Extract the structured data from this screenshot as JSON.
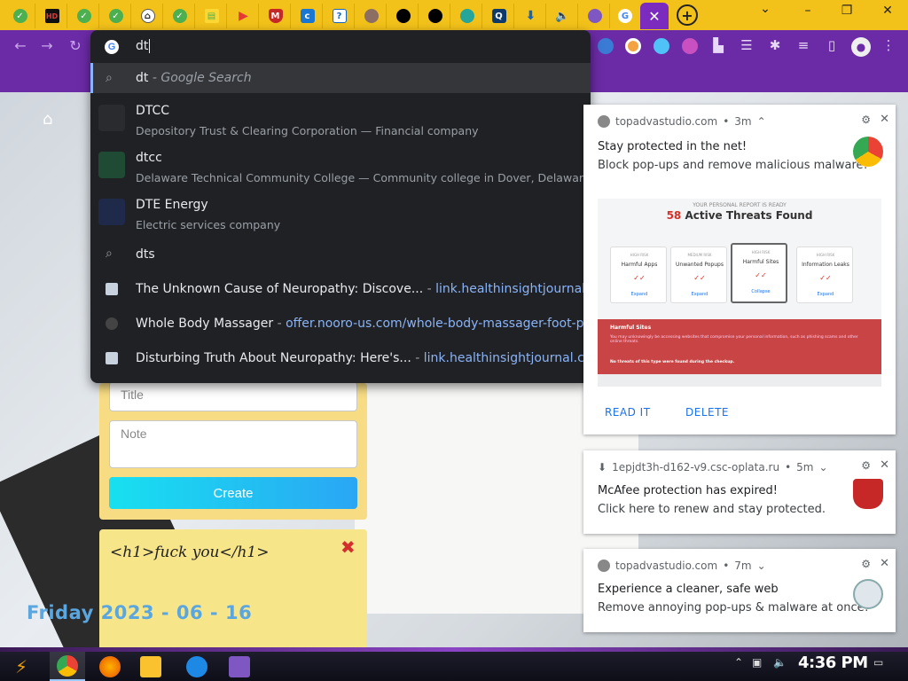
{
  "tabs": [
    {
      "icon": "check-icon"
    },
    {
      "icon": "hd-icon",
      "glyph": "HD"
    },
    {
      "icon": "check-icon"
    },
    {
      "icon": "check-icon"
    },
    {
      "icon": "home-icon"
    },
    {
      "icon": "check-icon"
    },
    {
      "icon": "doc-icon"
    },
    {
      "icon": "play-icon"
    },
    {
      "icon": "shield-icon"
    },
    {
      "icon": "c-icon",
      "glyph": "c"
    },
    {
      "icon": "question-icon",
      "glyph": "?"
    },
    {
      "icon": "circle-icon"
    },
    {
      "icon": "github-icon"
    },
    {
      "icon": "github-icon"
    },
    {
      "icon": "globe-icon"
    },
    {
      "icon": "qs-icon",
      "glyph": "Q"
    },
    {
      "icon": "download-icon",
      "glyph": "⬇"
    },
    {
      "icon": "sound-icon",
      "glyph": "🔈"
    },
    {
      "icon": "multi-icon"
    },
    {
      "icon": "google-icon",
      "glyph": "G"
    }
  ],
  "window_controls": {
    "minimize": "–",
    "restore": "❐",
    "close": "✕",
    "dropdown": "⌄"
  },
  "omnibox": {
    "query": "dt",
    "suggestions": [
      {
        "main": "dt",
        "hint": "- Google Search",
        "type": "search"
      },
      {
        "main": "DTCC",
        "sub": "Depository Trust & Clearing Corporation — Financial company",
        "type": "entity",
        "color": "#2a2b2e"
      },
      {
        "main": "dtcc",
        "sub": "Delaware Technical Community College — Community college in Dover, Delaware",
        "type": "entity",
        "color": "#1f4a33"
      },
      {
        "main": "DTE Energy",
        "sub": "Electric services company",
        "type": "entity",
        "color": "#1f2a4a"
      },
      {
        "main": "dts",
        "type": "search"
      },
      {
        "main": "The Unknown Cause of Neuropathy: Discove...",
        "sep": "-",
        "url": "link.healthinsightjournal.co...",
        "type": "history"
      },
      {
        "main": "Whole Body Massager",
        "sep": "-",
        "url": "offer.nooro-us.com/whole-body-massager-foot-pai...",
        "type": "history"
      },
      {
        "main": "Disturbing Truth About Neuropathy: Here's...",
        "sep": "-",
        "url": "link.healthinsightjournal.co...",
        "type": "history"
      }
    ]
  },
  "notes_app": {
    "title_placeholder": "Title",
    "note_placeholder": "Note",
    "create_label": "Create",
    "note_content": "<h1>fuck you</h1>",
    "delete_glyph": "✖",
    "date": "Friday 2023 - 06 - 16"
  },
  "notifications": [
    {
      "source": "topadvastudio.com",
      "time": "3m",
      "title": "Stay protected in the net!",
      "body": "Block pop-ups and remove malicious malware!",
      "image": {
        "small": "YOUR PERSONAL REPORT IS READY",
        "count": "58",
        "heading": "Active Threats Found",
        "cards": [
          {
            "risk": "HIGH RISK",
            "label": "Harmful Apps",
            "expand": "Expand"
          },
          {
            "risk": "MEDIUM RISK",
            "label": "Unwanted Popups",
            "expand": "Expand"
          },
          {
            "risk": "HIGH RISK",
            "label": "Harmful Sites",
            "expand": "Collapse"
          },
          {
            "risk": "HIGH RISK",
            "label": "Information Leaks",
            "expand": "Expand"
          }
        ],
        "red_title": "Harmful Sites",
        "red_text": "You may unknowingly be accessing websites that compromise your personal information, such as phishing scams and other online threats.",
        "red_foot": "No threats of this type were found during the checkup."
      },
      "actions": [
        "READ IT",
        "DELETE"
      ]
    },
    {
      "source": "1epjdt3h-d162-v9.csc-oplata.ru",
      "time": "5m",
      "title": "McAfee protection has expired!",
      "body": "Click here to renew and stay protected."
    },
    {
      "source": "topadvastudio.com",
      "time": "7m",
      "title": "Experience a cleaner, safe web",
      "body": "Remove annoying pop-ups & malware at once!"
    }
  ],
  "taskbar": {
    "clock": "4:36 PM",
    "apps": [
      "chrome-icon",
      "firefox-icon",
      "files-icon",
      "ie-icon",
      "visual-studio-icon"
    ]
  }
}
